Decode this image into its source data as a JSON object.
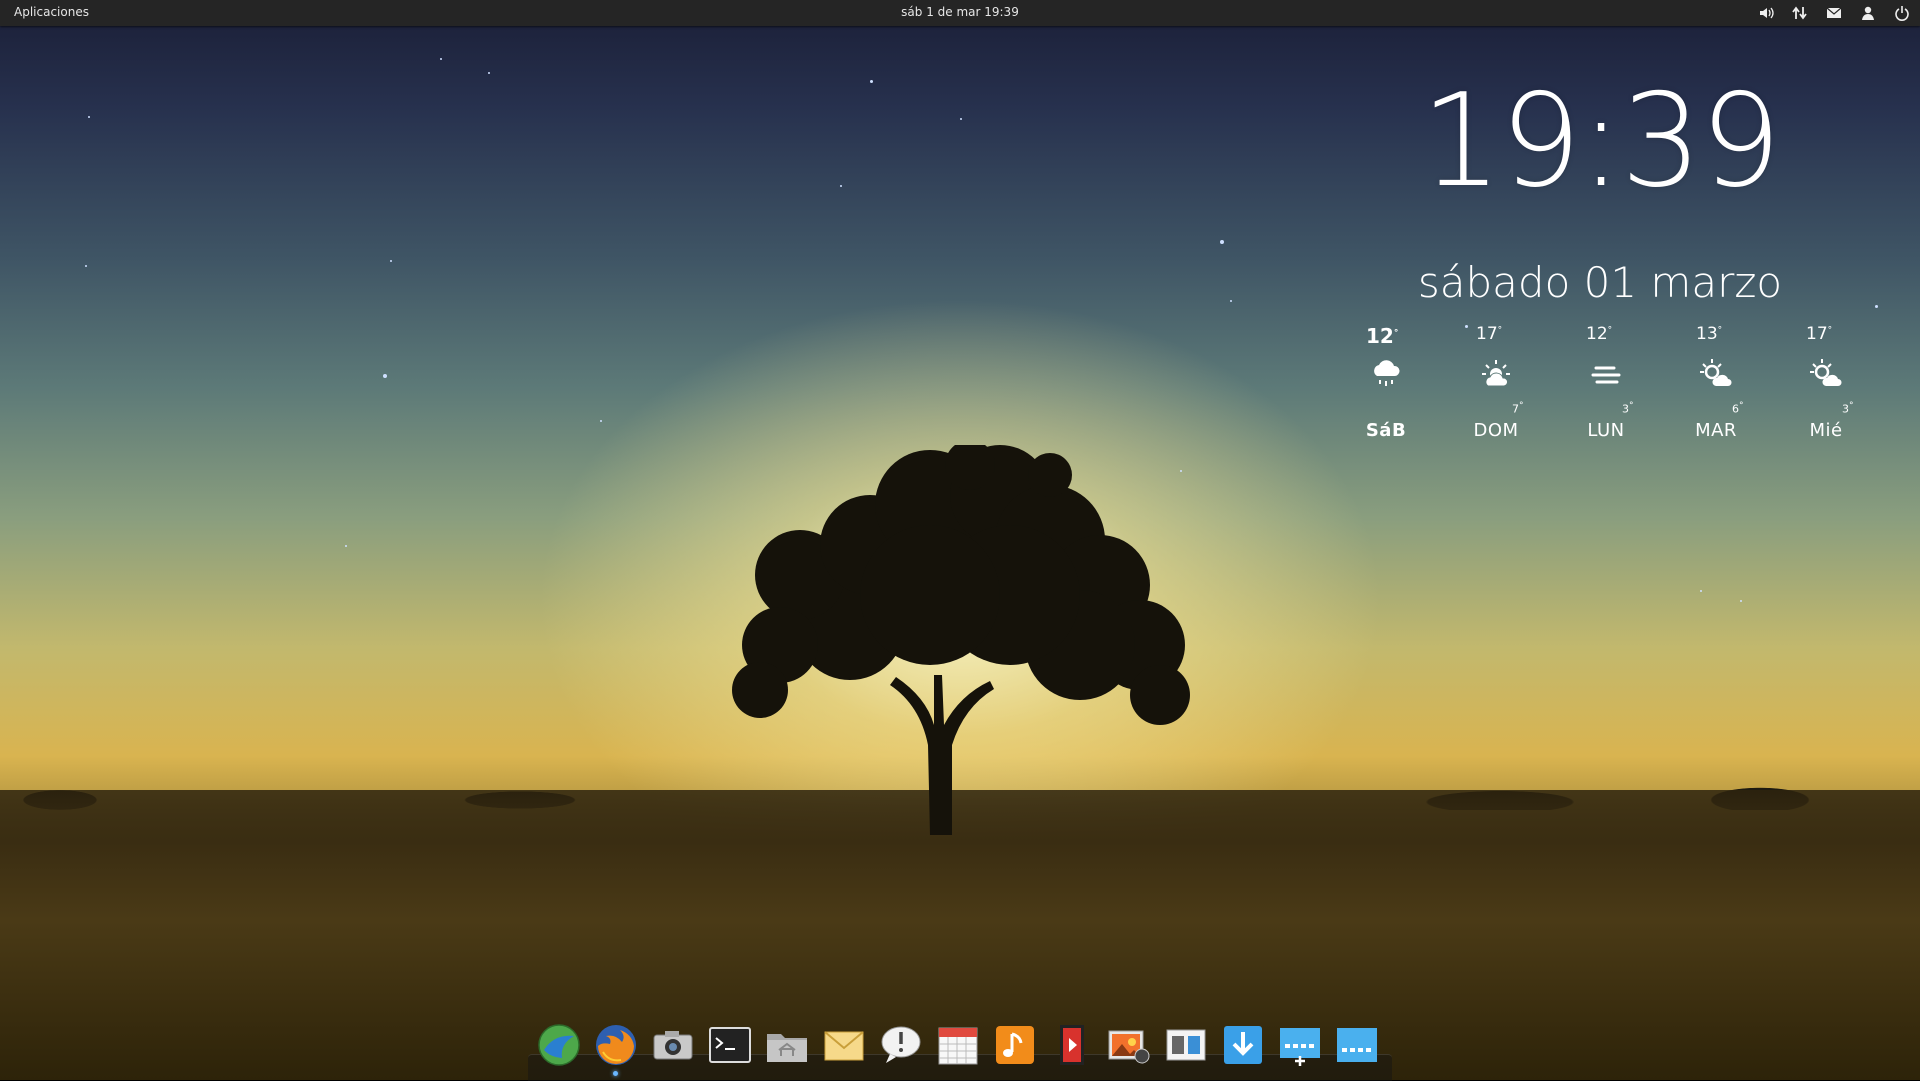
{
  "panel": {
    "apps_label": "Aplicaciones",
    "clock": "sáb  1 de mar 19:39",
    "indicators": [
      "volume-icon",
      "network-icon",
      "mail-icon",
      "user-icon",
      "power-icon"
    ]
  },
  "widget": {
    "time": "19:39",
    "date": "sábado 01 marzo",
    "forecast": [
      {
        "day": "SáB",
        "high": "12",
        "low": "",
        "condition": "rain-cloud-icon",
        "today": true
      },
      {
        "day": "DOM",
        "high": "17",
        "low": "7",
        "condition": "partly-cloudy-icon"
      },
      {
        "day": "LUN",
        "high": "12",
        "low": "3",
        "condition": "fog-icon"
      },
      {
        "day": "MAR",
        "high": "13",
        "low": "6",
        "condition": "sun-cloud-icon"
      },
      {
        "day": "Mié",
        "high": "17",
        "low": "3",
        "condition": "sun-cloud-icon"
      }
    ],
    "degree": "°"
  },
  "dock": {
    "items": [
      {
        "name": "browser-midori-icon",
        "running": false
      },
      {
        "name": "firefox-icon",
        "running": true
      },
      {
        "name": "camera-icon",
        "running": false
      },
      {
        "name": "terminal-icon",
        "running": false
      },
      {
        "name": "home-folder-icon",
        "running": false
      },
      {
        "name": "mail-app-icon",
        "running": false
      },
      {
        "name": "chat-icon",
        "running": false
      },
      {
        "name": "calendar-icon",
        "running": false
      },
      {
        "name": "music-icon",
        "running": false
      },
      {
        "name": "video-icon",
        "running": false
      },
      {
        "name": "photos-icon",
        "running": false
      },
      {
        "name": "settings-icon",
        "running": false
      },
      {
        "name": "software-center-icon",
        "running": false
      },
      {
        "name": "workspace-add-icon",
        "running": false
      },
      {
        "name": "workspace-icon",
        "running": false
      }
    ]
  },
  "colors": {
    "panel": "#252525",
    "accent": "#6ab7ff"
  }
}
